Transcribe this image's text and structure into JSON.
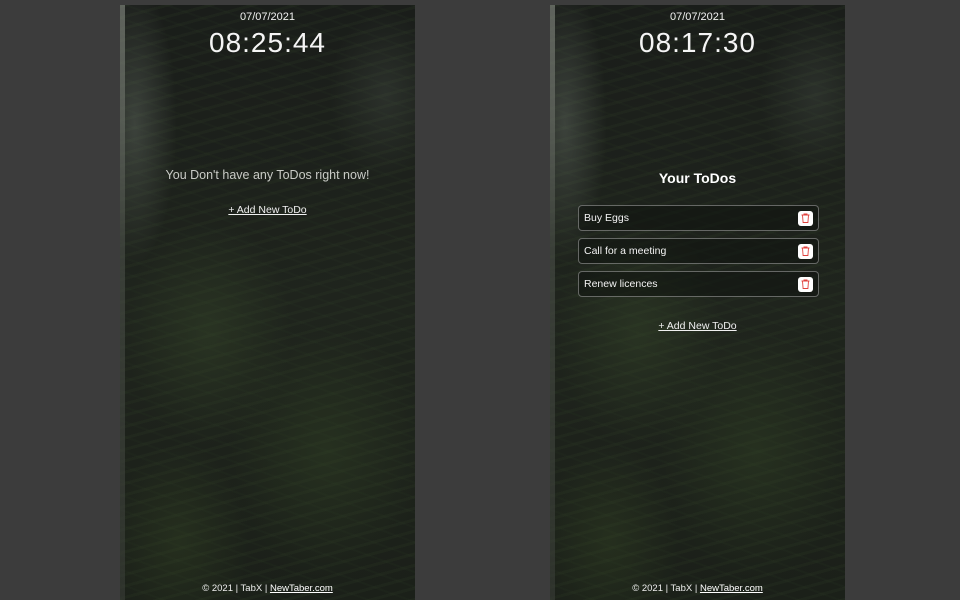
{
  "left_screen": {
    "date": "07/07/2021",
    "time": "08:25:44",
    "empty_message": "You Don't have any ToDos right now!",
    "add_link": "+ Add New ToDo",
    "footer": {
      "copyright": "© 2021 | TabX | ",
      "site_link": "NewTaber.com"
    }
  },
  "right_screen": {
    "date": "07/07/2021",
    "time": "08:17:30",
    "todos_title": "Your ToDos",
    "todos": [
      {
        "text": "Buy Eggs",
        "icon": "trash-icon"
      },
      {
        "text": "Call for a meeting",
        "icon": "trash-icon"
      },
      {
        "text": "Renew licences",
        "icon": "trash-icon"
      }
    ],
    "add_link": "+ Add New ToDo",
    "footer": {
      "copyright": "© 2021 | TabX | ",
      "site_link": "NewTaber.com"
    }
  },
  "colors": {
    "page_background": "#3c3c3c",
    "text": "#f5f5f5",
    "trash_icon": "#e0413c"
  }
}
